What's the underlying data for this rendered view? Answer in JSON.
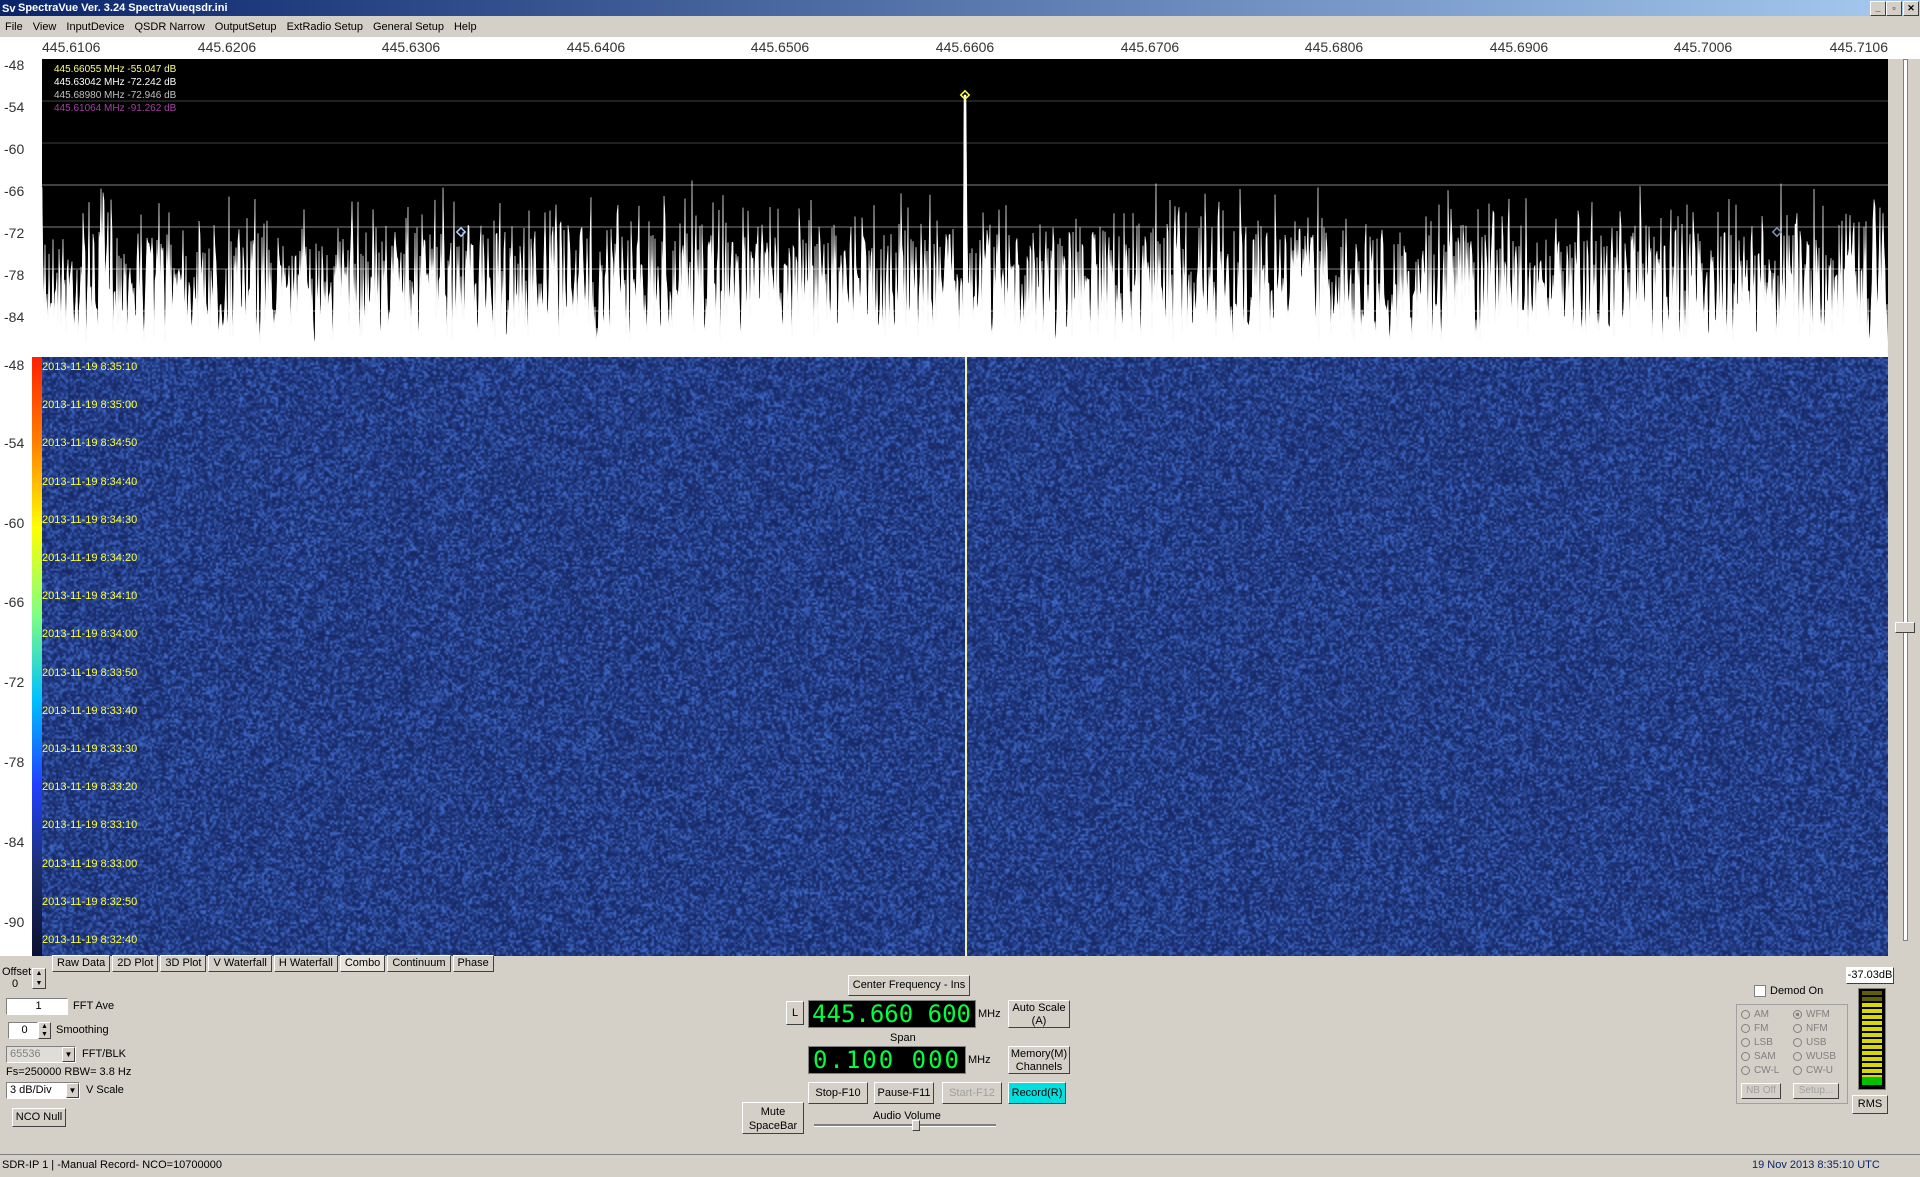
{
  "window": {
    "title": "SpectraVue Ver. 3.24  SpectraVueqsdr.ini",
    "icon_text": "Sv"
  },
  "menu": [
    "File",
    "View",
    "InputDevice",
    "QSDR Narrow",
    "OutputSetup",
    "ExtRadio Setup",
    "General Setup",
    "Help"
  ],
  "freq_axis": [
    "445.6106",
    "445.6206",
    "445.6306",
    "445.6406",
    "445.6506",
    "445.6606",
    "445.6706",
    "445.6806",
    "445.6906",
    "445.7006",
    "445.7106"
  ],
  "spectrum_db_axis": [
    "-48",
    "-54",
    "-60",
    "-66",
    "-72",
    "-78",
    "-84"
  ],
  "waterfall_db_axis": [
    "-48",
    "-54",
    "-60",
    "-66",
    "-72",
    "-78",
    "-84",
    "-90"
  ],
  "markers": [
    {
      "text": "445.66055 MHz -55.047 dB",
      "color": "#ffff80"
    },
    {
      "text": "445.63042 MHz -72.242 dB",
      "color": "#ffffff"
    },
    {
      "text": "445.68980 MHz -72.946 dB",
      "color": "#c0c0c0"
    },
    {
      "text": "445.61064 MHz -91.262 dB",
      "color": "#a040a0"
    }
  ],
  "waterfall_timestamps": [
    "2013-11-19 8:35:10",
    "2013-11-19 8:35:00",
    "2013-11-19 8:34:50",
    "2013-11-19 8:34:40",
    "2013-11-19 8:34:30",
    "2013-11-19 8:34:20",
    "2013-11-19 8:34:10",
    "2013-11-19 8:34:00",
    "2013-11-19 8:33:50",
    "2013-11-19 8:33:40",
    "2013-11-19 8:33:30",
    "2013-11-19 8:33:20",
    "2013-11-19 8:33:10",
    "2013-11-19 8:33:00",
    "2013-11-19 8:32:50",
    "2013-11-19 8:32:40"
  ],
  "tabs": [
    "Raw Data",
    "2D Plot",
    "3D Plot",
    "V Waterfall",
    "H Waterfall",
    "Combo",
    "Continuum",
    "Phase"
  ],
  "active_tab": "Combo",
  "left_panel": {
    "offset_label": "Offset",
    "offset_value": "0",
    "fft_ave_value": "1",
    "fft_ave_label": "FFT Ave",
    "smoothing_value": "0",
    "smoothing_label": "Smoothing",
    "fft_blk_value": "65536",
    "fft_blk_label": "FFT/BLK",
    "fs_rbw": "Fs=250000 RBW= 3.8 Hz",
    "vscale_value": "3 dB/Div",
    "vscale_label": "V Scale",
    "nco_null": "NCO Null"
  },
  "center_panel": {
    "center_freq_button": "Center Frequency - Ins",
    "lock_button": "L",
    "center_freq": "445.660 600",
    "center_unit": "MHz",
    "autoscale": "Auto Scale (A)",
    "span_label": "Span",
    "span_value": "0.100 000",
    "span_unit": "MHz",
    "memory": "Memory(M) Channels",
    "stop": "Stop-F10",
    "pause": "Pause-F11",
    "start": "Start-F12",
    "record": "Record(R)",
    "mute": "Mute SpaceBar",
    "audio_volume": "Audio Volume"
  },
  "demod_panel": {
    "demod_on": "Demod On",
    "level": "-37.03dB",
    "modes_left": [
      "AM",
      "FM",
      "LSB",
      "SAM",
      "CW-L"
    ],
    "modes_right": [
      "WFM",
      "NFM",
      "USB",
      "WUSB",
      "CW-U"
    ],
    "nb_off": "NB Off",
    "setup": "Setup...",
    "rms": "RMS"
  },
  "status": {
    "left": "SDR-IP 1  | -Manual Record-   NCO=10700000",
    "right": "19 Nov 2013   8:35:10 UTC"
  },
  "colors": {
    "accent_record": "#00e0e0",
    "lcd_green": "#00ff40",
    "title_blue": "#0a246a"
  }
}
